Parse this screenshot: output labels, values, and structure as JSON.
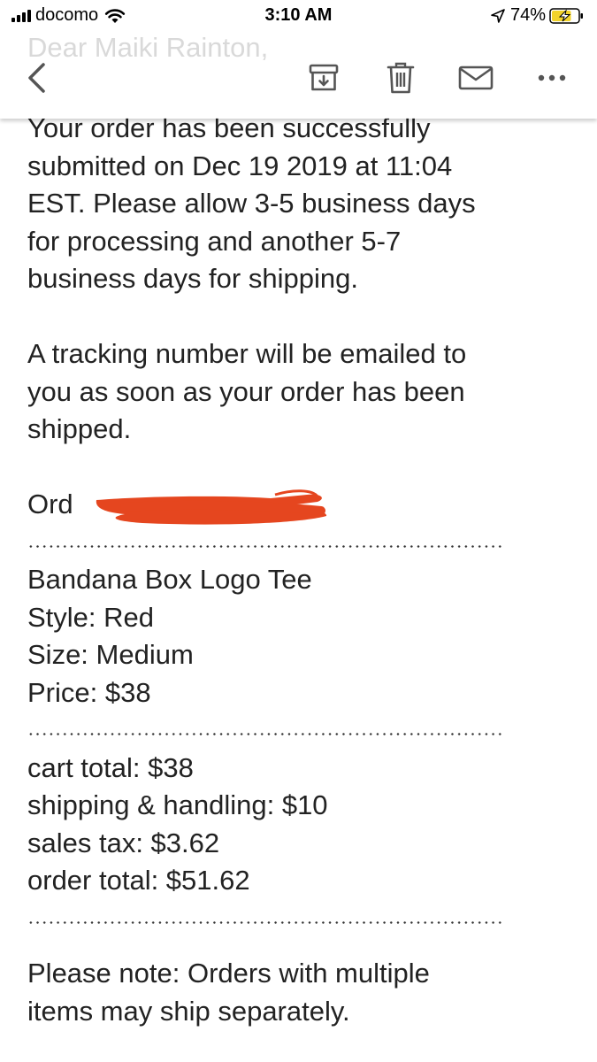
{
  "status_bar": {
    "carrier": "docomo",
    "time": "3:10 AM",
    "battery_percent": "74%",
    "battery_level": 0.74,
    "charging": true
  },
  "toolbar": {
    "icons": [
      "back-chevron-icon",
      "archive-icon",
      "trash-icon",
      "mail-icon",
      "more-icon"
    ]
  },
  "email": {
    "greeting": "Dear Maiki Rainton,",
    "paragraph1_lines": [
      "Your order has been successfully",
      "submitted on Dec 19 2019 at 11:04",
      "EST. Please allow 3-5 business days",
      "for processing and another 5-7",
      "business days for shipping."
    ],
    "paragraph2_lines": [
      "A tracking number will be emailed to",
      "you as soon as your order has been",
      "shipped."
    ],
    "order_label_visible": "Ord",
    "item": {
      "name": "Bandana Box Logo Tee",
      "style": "Style: Red",
      "size": "Size: Medium",
      "price": "Price: $38"
    },
    "totals": {
      "cart_total": "cart total: $38",
      "shipping": "shipping & handling: $10",
      "sales_tax": "sales tax: $3.62",
      "order_total": "order total: $51.62"
    },
    "note_lines": [
      "Please note: Orders with multiple",
      "items may ship separately."
    ]
  },
  "colors": {
    "redaction": "#e5461f",
    "battery_fill": "#f2d32b",
    "text": "#222222"
  }
}
